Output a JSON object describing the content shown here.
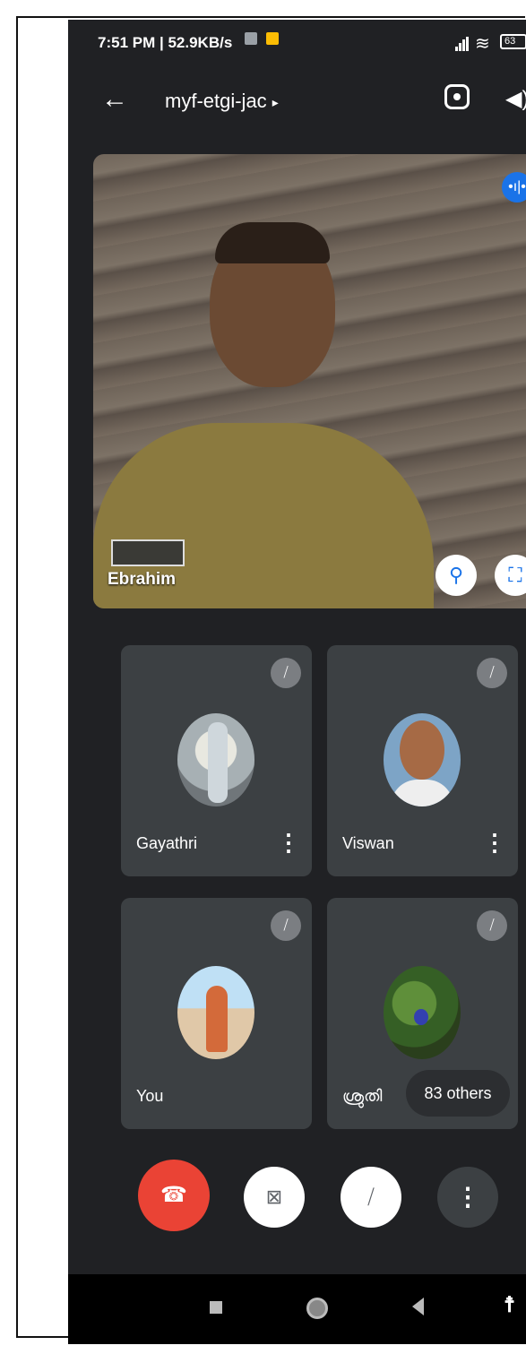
{
  "status_bar": {
    "text": "7:51 PM | 52.9KB/s",
    "battery": "63"
  },
  "header": {
    "meeting_code": "myf-etgi-jac",
    "chevron": "▸"
  },
  "main_video": {
    "participant_name": "Ebrahim",
    "live_indicator": "•ı|•",
    "pin_icon": "pin-icon",
    "fullscreen_icon": "fullscreen-icon"
  },
  "tiles": [
    {
      "name": "Gayathri",
      "muted": true,
      "avatar": "photo"
    },
    {
      "name": "Viswan",
      "muted": true,
      "avatar": "photo"
    },
    {
      "name": "You",
      "muted": true,
      "avatar": "photo"
    },
    {
      "name": "ശ്രുതി",
      "muted": true,
      "avatar": "photo",
      "others_label": "83 others"
    }
  ],
  "controls": {
    "end_call": "end-call-icon",
    "camera": "camera-off-icon",
    "mic": "mic-off-icon",
    "more": "more-vert-icon"
  },
  "colors": {
    "background": "#202124",
    "tile": "#3c4043",
    "end_call": "#ea4335",
    "accent": "#1a73e8"
  }
}
